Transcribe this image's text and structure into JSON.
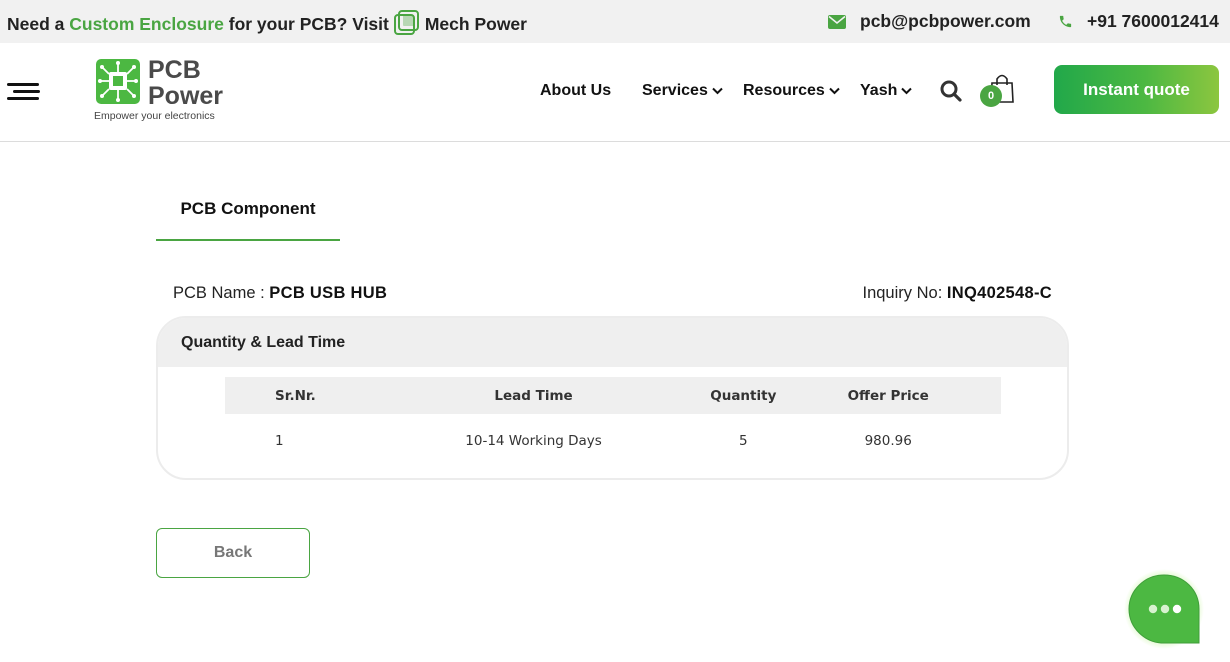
{
  "topbar": {
    "promo_prefix": "Need a ",
    "promo_highlight": "Custom Enclosure",
    "promo_middle": " for your PCB? Visit",
    "promo_brand": "Mech Power",
    "promo_brand_icon": "mech-power-logo-icon",
    "email": "pcb@pcbpower.com",
    "email_icon": "envelope-icon",
    "phone": "+91 7600012414",
    "phone_icon": "phone-icon"
  },
  "header": {
    "logo_line1": "PCB",
    "logo_line2": "Power",
    "logo_tagline": "Empower your electronics",
    "nav": [
      {
        "label": "About Us",
        "dropdown": false
      },
      {
        "label": "Services",
        "dropdown": true
      },
      {
        "label": "Resources",
        "dropdown": true
      },
      {
        "label": "Yash",
        "dropdown": true
      }
    ],
    "cart_count": "0",
    "quote_label": "Instant quote"
  },
  "page": {
    "tab_label": "PCB Component",
    "pcb_name_label": "PCB Name :",
    "pcb_name_value": "PCB USB HUB",
    "inquiry_label": "Inquiry No:",
    "inquiry_value": "INQ402548-C",
    "card_title": "Quantity & Lead Time",
    "table": {
      "headers": [
        "Sr.Nr.",
        "Lead Time",
        "Quantity",
        "Offer Price"
      ],
      "rows": [
        [
          "1",
          "10-14 Working Days",
          "5",
          "980.96"
        ]
      ]
    },
    "back_label": "Back"
  },
  "colors": {
    "accent_green": "#4aa542",
    "topbar_bg": "#f1f1f1",
    "panel_bg": "#efefef"
  }
}
